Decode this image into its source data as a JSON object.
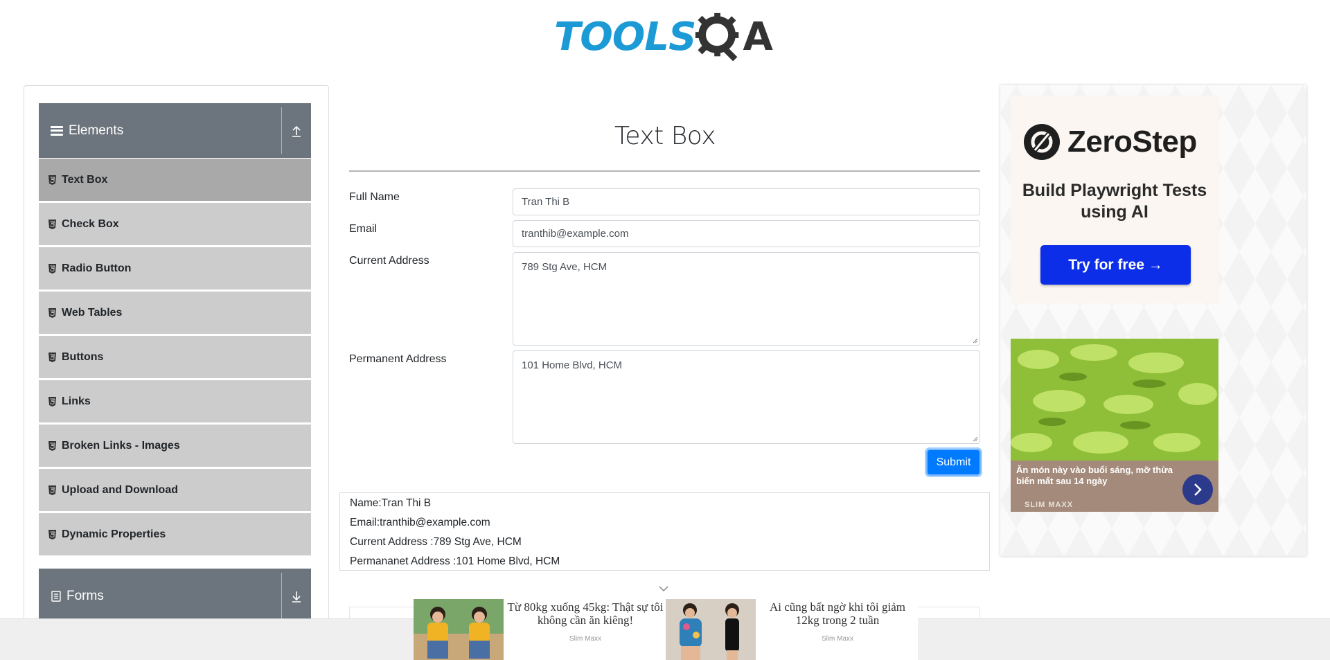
{
  "header": {
    "logo_tools": "TOOLS",
    "logo_a": "A"
  },
  "sidebar": {
    "group_elements": "Elements",
    "items": [
      {
        "label": "Text Box"
      },
      {
        "label": "Check Box"
      },
      {
        "label": "Radio Button"
      },
      {
        "label": "Web Tables"
      },
      {
        "label": "Buttons"
      },
      {
        "label": "Links"
      },
      {
        "label": "Broken Links - Images"
      },
      {
        "label": "Upload and Download"
      },
      {
        "label": "Dynamic Properties"
      }
    ],
    "group_forms": "Forms",
    "active_item": "Text Box"
  },
  "main": {
    "title": "Text Box",
    "full_name_label": "Full Name",
    "full_name_value": "Tran Thi B",
    "email_label": "Email",
    "email_value": "tranthib@example.com",
    "current_address_label": "Current Address",
    "current_address_value": "789 Stg Ave, HCM",
    "permanent_address_label": "Permanent Address",
    "permanent_address_value": "101 Home Blvd, HCM",
    "submit_label": "Submit",
    "output": {
      "name": "Name:Tran Thi B",
      "email": "Email:tranthib@example.com",
      "current_address": "Current Address :789 Stg Ave, HCM",
      "permanent_address": "Permananet Address :101 Home Blvd, HCM"
    }
  },
  "right_ad": {
    "brand": "ZeroStep",
    "tagline": "Build Playwright Tests using AI",
    "cta": "Try for free →",
    "food_text": "Ăn món này vào buổi sáng, mỡ thừa biến mất sau 14 ngày",
    "food_brand": "SLIM MAXX"
  },
  "bottom_ad": {
    "item1_text": "Từ 80kg xuống 45kg: Thật sự tôi không cần ăn kiêng!",
    "item1_brand": "Slim Maxx",
    "item2_text": "Ai cũng bất ngờ khi tôi giảm 12kg trong 2 tuần",
    "item2_brand": "Slim Maxx"
  },
  "colors": {
    "logo_blue": "#1b9ad6",
    "sidebar_header": "#6c757d",
    "sidebar_item": "#cccccc",
    "sidebar_active": "#a9a9a9",
    "submit_button": "#007bff",
    "zerostep_button": "#0d2ee8"
  }
}
